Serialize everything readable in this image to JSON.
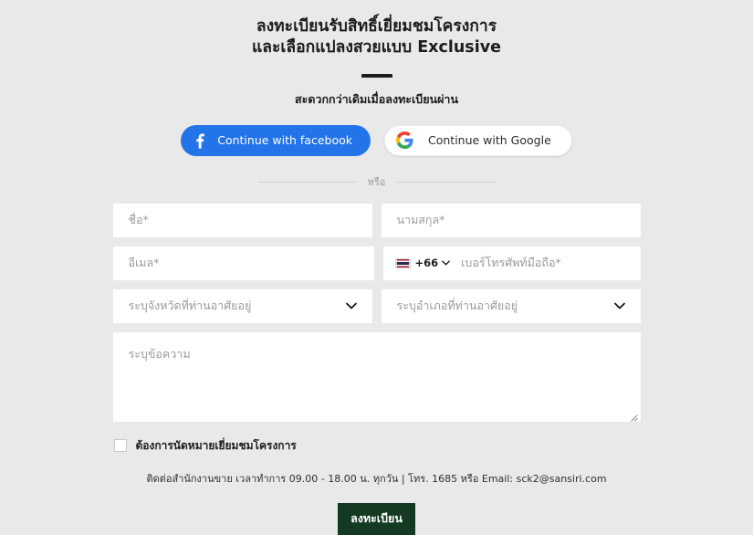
{
  "heading": {
    "line1": "ลงทะเบียนรับสิทธิ์เยี่ยมชมโครงการ",
    "line2": "และเลือกแปลงสวยแบบ Exclusive"
  },
  "subheading": "สะดวกกว่าเดิมเมื่อลงทะเบียนผ่าน",
  "social": {
    "facebook_label": "Continue with facebook",
    "google_label": "Continue with Google",
    "facebook_color": "#2374e8",
    "google_bg": "#ffffff"
  },
  "divider": {
    "label": "หรือ"
  },
  "form": {
    "first_name_placeholder": "ชื่อ*",
    "last_name_placeholder": "นามสกุล*",
    "email_placeholder": "อีเมล*",
    "phone_placeholder": "เบอร์โทรศัพท์มือถือ*",
    "country_code": "+66",
    "country_flag": "thailand-flag-icon",
    "province_placeholder": "ระบุจังหวัดที่ท่านอาศัยอยู่",
    "district_placeholder": "ระบุอำเภอที่ท่านอาศัยอยู่",
    "message_placeholder": "ระบุข้อความ",
    "first_name_value": "",
    "last_name_value": "",
    "email_value": "",
    "phone_value": "",
    "message_value": ""
  },
  "checkbox": {
    "label": "ต้องการนัดหมายเยี่ยมชมโครงการ",
    "checked": false
  },
  "contact_note": "ติดต่อสำนักงานขาย เวลาทำการ 09.00 - 18.00 น. ทุกวัน | โทร. 1685 หรือ Email: sck2@sansiri.com",
  "submit": {
    "label": "ลงทะเบียน",
    "color": "#153a22"
  },
  "theme": {
    "background": "#e9e9e9",
    "field_bg": "#ffffff",
    "placeholder_color": "#9a9a9a",
    "text_color": "#1c1c1c"
  }
}
